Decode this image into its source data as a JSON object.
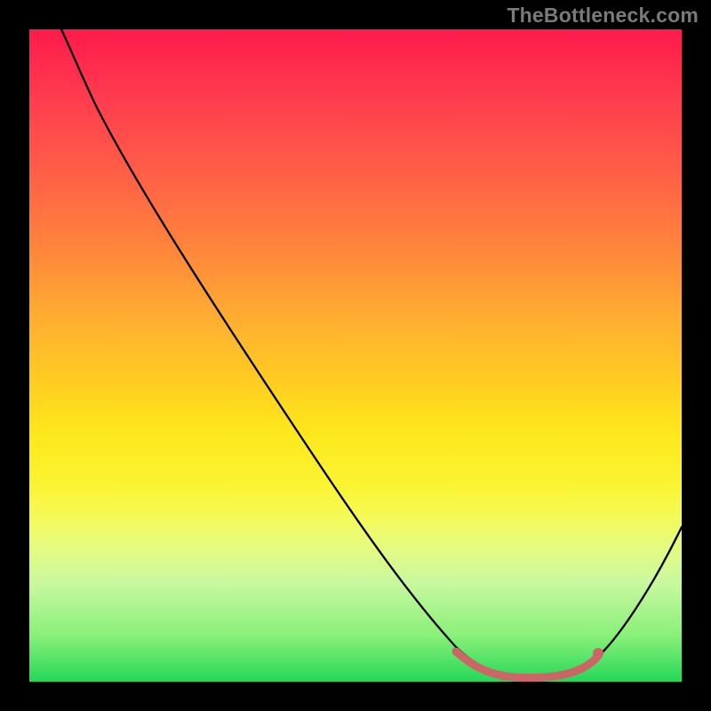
{
  "watermark": "TheBottleneck.com",
  "colors": {
    "background": "#000000",
    "curve": "#000000",
    "marker": "#cc6666",
    "gradient_stops": [
      {
        "pos": 0,
        "hex": "#ff1a4a"
      },
      {
        "pos": 25,
        "hex": "#ff6844"
      },
      {
        "pos": 55,
        "hex": "#ffd020"
      },
      {
        "pos": 75,
        "hex": "#f4fa5a"
      },
      {
        "pos": 100,
        "hex": "#23d858"
      }
    ]
  },
  "chart_data": {
    "type": "line",
    "title": "",
    "xlabel": "",
    "ylabel": "",
    "xlim": [
      0,
      100
    ],
    "ylim": [
      0,
      100
    ],
    "series": [
      {
        "name": "bottleneck-curve",
        "x": [
          0,
          5,
          10,
          15,
          20,
          25,
          30,
          35,
          40,
          45,
          50,
          55,
          60,
          63,
          67,
          70,
          73,
          77,
          80,
          83,
          87,
          90,
          95,
          100
        ],
        "y": [
          100,
          97,
          93,
          88,
          82,
          75,
          68,
          61,
          54,
          46,
          39,
          32,
          24,
          19,
          13,
          9,
          5,
          2,
          1,
          1,
          2,
          6,
          15,
          26
        ]
      },
      {
        "name": "optimal-range-marker",
        "x": [
          67,
          70,
          73,
          77,
          80,
          83,
          86,
          87
        ],
        "y": [
          4,
          2,
          1,
          1,
          1,
          1,
          2,
          3
        ]
      }
    ],
    "annotations": [
      {
        "name": "marker-end-dot",
        "x": 87,
        "y": 3
      }
    ]
  }
}
